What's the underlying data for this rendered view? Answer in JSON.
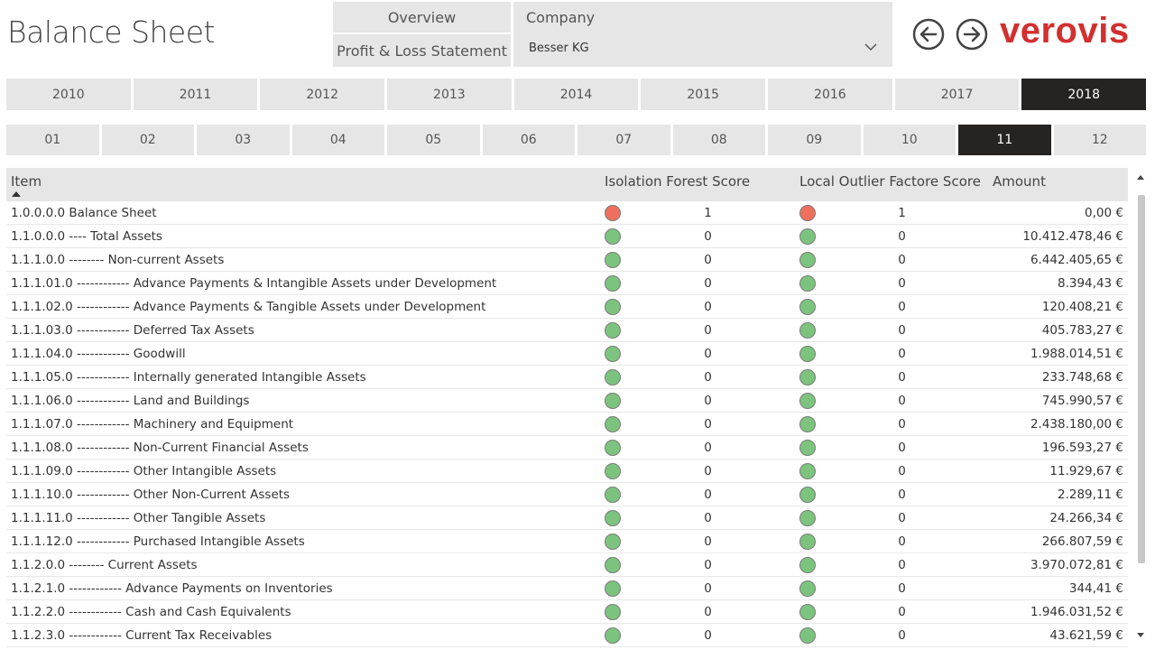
{
  "page": {
    "title": "Balance Sheet"
  },
  "nav": {
    "overview_label": "Overview",
    "pl_label": "Profit & Loss Statement"
  },
  "company": {
    "label": "Company",
    "value": "Besser KG"
  },
  "logo": {
    "text": "verovis",
    "color": "#d32f2f"
  },
  "years": [
    "2010",
    "2011",
    "2012",
    "2013",
    "2014",
    "2015",
    "2016",
    "2017",
    "2018"
  ],
  "selected_year": "2018",
  "months": [
    "01",
    "02",
    "03",
    "04",
    "05",
    "06",
    "07",
    "08",
    "09",
    "10",
    "11",
    "12"
  ],
  "selected_month": "11",
  "colors": {
    "status_red": "#ef6f5e",
    "status_green": "#7cc47e",
    "active_bg": "#252423",
    "inactive_bg": "#e6e6e6"
  },
  "table": {
    "headers": {
      "item": "Item",
      "isolation_forest": "Isolation Forest Score",
      "local_outlier": "Local Outlier Factore Score",
      "amount": "Amount"
    },
    "sort": "ascending",
    "rows": [
      {
        "item": "1.0.0.0.0 Balance Sheet",
        "if_status": "red",
        "if_score": "1",
        "lof_status": "red",
        "lof_score": "1",
        "amount": "0,00 €"
      },
      {
        "item": "1.1.0.0.0 ---- Total Assets",
        "if_status": "green",
        "if_score": "0",
        "lof_status": "green",
        "lof_score": "0",
        "amount": "10.412.478,46 €"
      },
      {
        "item": "1.1.1.0.0 -------- Non-current Assets",
        "if_status": "green",
        "if_score": "0",
        "lof_status": "green",
        "lof_score": "0",
        "amount": "6.442.405,65 €"
      },
      {
        "item": "1.1.1.01.0 ------------ Advance Payments & Intangible Assets under Development",
        "if_status": "green",
        "if_score": "0",
        "lof_status": "green",
        "lof_score": "0",
        "amount": "8.394,43 €"
      },
      {
        "item": "1.1.1.02.0 ------------ Advance Payments & Tangible Assets under Development",
        "if_status": "green",
        "if_score": "0",
        "lof_status": "green",
        "lof_score": "0",
        "amount": "120.408,21 €"
      },
      {
        "item": "1.1.1.03.0 ------------ Deferred Tax Assets",
        "if_status": "green",
        "if_score": "0",
        "lof_status": "green",
        "lof_score": "0",
        "amount": "405.783,27 €"
      },
      {
        "item": "1.1.1.04.0 ------------ Goodwill",
        "if_status": "green",
        "if_score": "0",
        "lof_status": "green",
        "lof_score": "0",
        "amount": "1.988.014,51 €"
      },
      {
        "item": "1.1.1.05.0 ------------ Internally generated Intangible Assets",
        "if_status": "green",
        "if_score": "0",
        "lof_status": "green",
        "lof_score": "0",
        "amount": "233.748,68 €"
      },
      {
        "item": "1.1.1.06.0 ------------ Land and Buildings",
        "if_status": "green",
        "if_score": "0",
        "lof_status": "green",
        "lof_score": "0",
        "amount": "745.990,57 €"
      },
      {
        "item": "1.1.1.07.0 ------------ Machinery and Equipment",
        "if_status": "green",
        "if_score": "0",
        "lof_status": "green",
        "lof_score": "0",
        "amount": "2.438.180,00 €"
      },
      {
        "item": "1.1.1.08.0 ------------ Non-Current Financial Assets",
        "if_status": "green",
        "if_score": "0",
        "lof_status": "green",
        "lof_score": "0",
        "amount": "196.593,27 €"
      },
      {
        "item": "1.1.1.09.0 ------------ Other Intangible Assets",
        "if_status": "green",
        "if_score": "0",
        "lof_status": "green",
        "lof_score": "0",
        "amount": "11.929,67 €"
      },
      {
        "item": "1.1.1.10.0 ------------ Other Non-Current Assets",
        "if_status": "green",
        "if_score": "0",
        "lof_status": "green",
        "lof_score": "0",
        "amount": "2.289,11 €"
      },
      {
        "item": "1.1.1.11.0 ------------ Other Tangible Assets",
        "if_status": "green",
        "if_score": "0",
        "lof_status": "green",
        "lof_score": "0",
        "amount": "24.266,34 €"
      },
      {
        "item": "1.1.1.12.0 ------------ Purchased Intangible Assets",
        "if_status": "green",
        "if_score": "0",
        "lof_status": "green",
        "lof_score": "0",
        "amount": "266.807,59 €"
      },
      {
        "item": "1.1.2.0.0 -------- Current Assets",
        "if_status": "green",
        "if_score": "0",
        "lof_status": "green",
        "lof_score": "0",
        "amount": "3.970.072,81 €"
      },
      {
        "item": "1.1.2.1.0 ------------ Advance Payments on Inventories",
        "if_status": "green",
        "if_score": "0",
        "lof_status": "green",
        "lof_score": "0",
        "amount": "344,41 €"
      },
      {
        "item": "1.1.2.2.0 ------------ Cash and Cash Equivalents",
        "if_status": "green",
        "if_score": "0",
        "lof_status": "green",
        "lof_score": "0",
        "amount": "1.946.031,52 €"
      },
      {
        "item": "1.1.2.3.0 ------------ Current Tax Receivables",
        "if_status": "green",
        "if_score": "0",
        "lof_status": "green",
        "lof_score": "0",
        "amount": "43.621,59 €"
      },
      {
        "item": "",
        "if_status": "green",
        "if_score": "",
        "lof_status": "green",
        "lof_score": "",
        "amount": ""
      }
    ]
  },
  "icons": {
    "back": "arrow-left-circle-icon",
    "forward": "arrow-right-circle-icon",
    "dropdown": "chevron-down-icon"
  }
}
